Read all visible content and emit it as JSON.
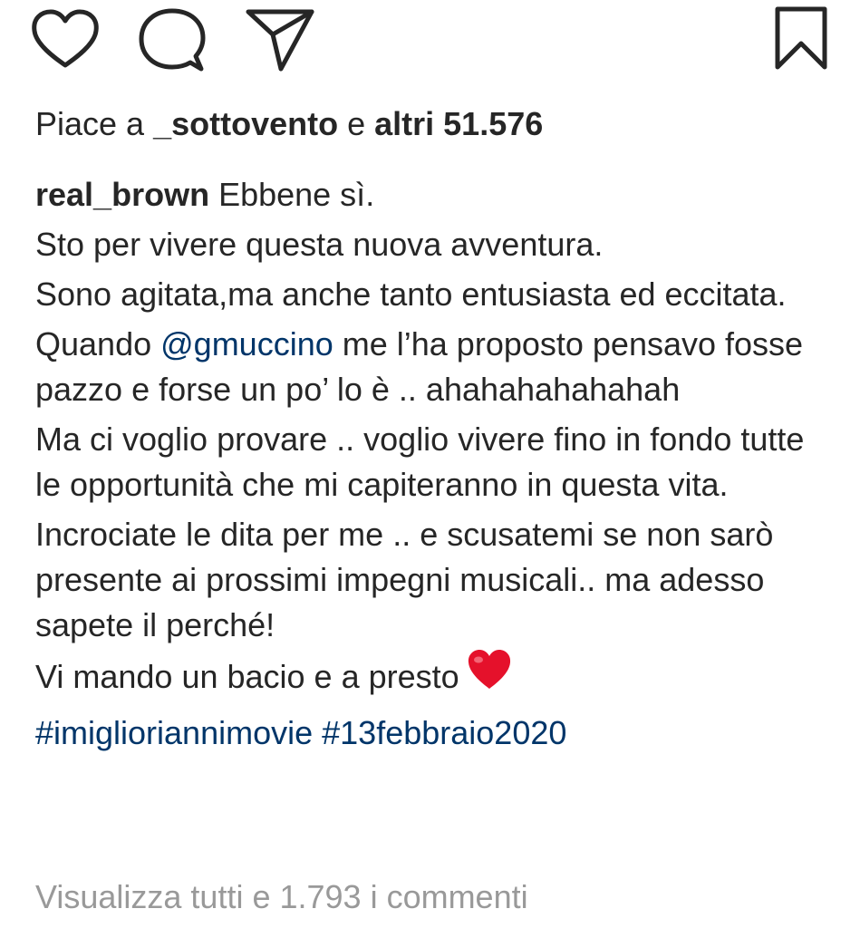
{
  "actions": {
    "like_icon": "heart-outline-icon",
    "comment_icon": "speech-bubble-icon",
    "share_icon": "paper-plane-icon",
    "save_icon": "bookmark-icon"
  },
  "likes": {
    "prefix": "Piace a ",
    "first_user": "_sottovento",
    "conjunction": " e ",
    "others": "altri 51.576"
  },
  "caption": {
    "username": "real_brown",
    "first_line": " Ebbene sì.",
    "p1": "Sto per vivere questa nuova avventura.",
    "p2": "Sono agitata,ma anche tanto entusiasta ed eccitata.",
    "p3_before": "Quando ",
    "p3_mention": "@gmuccino",
    "p3_after": " me l’ha proposto pensavo fosse pazzo e forse un po’ lo è .. ahahahahahahah",
    "p4": "Ma ci voglio provare .. voglio vivere fino in fondo tutte le opportunità che mi capiteranno in questa vita.",
    "p5": "Incrociate le dita per me .. e scusatemi se non sarò presente ai prossimi impegni musicali.. ma adesso sapete il perché!",
    "p6": "Vi mando un bacio e a presto",
    "emoji": "red-heart-emoji",
    "hashtag1": "#imiglioriannimovie",
    "hashtag2": "#13febbraio2020"
  },
  "comments": {
    "view_all": "Visualizza tutti e 1.793 i commenti"
  },
  "colors": {
    "text": "#262626",
    "link": "#003569",
    "muted": "#999999",
    "emoji_heart": "#e5112b"
  }
}
